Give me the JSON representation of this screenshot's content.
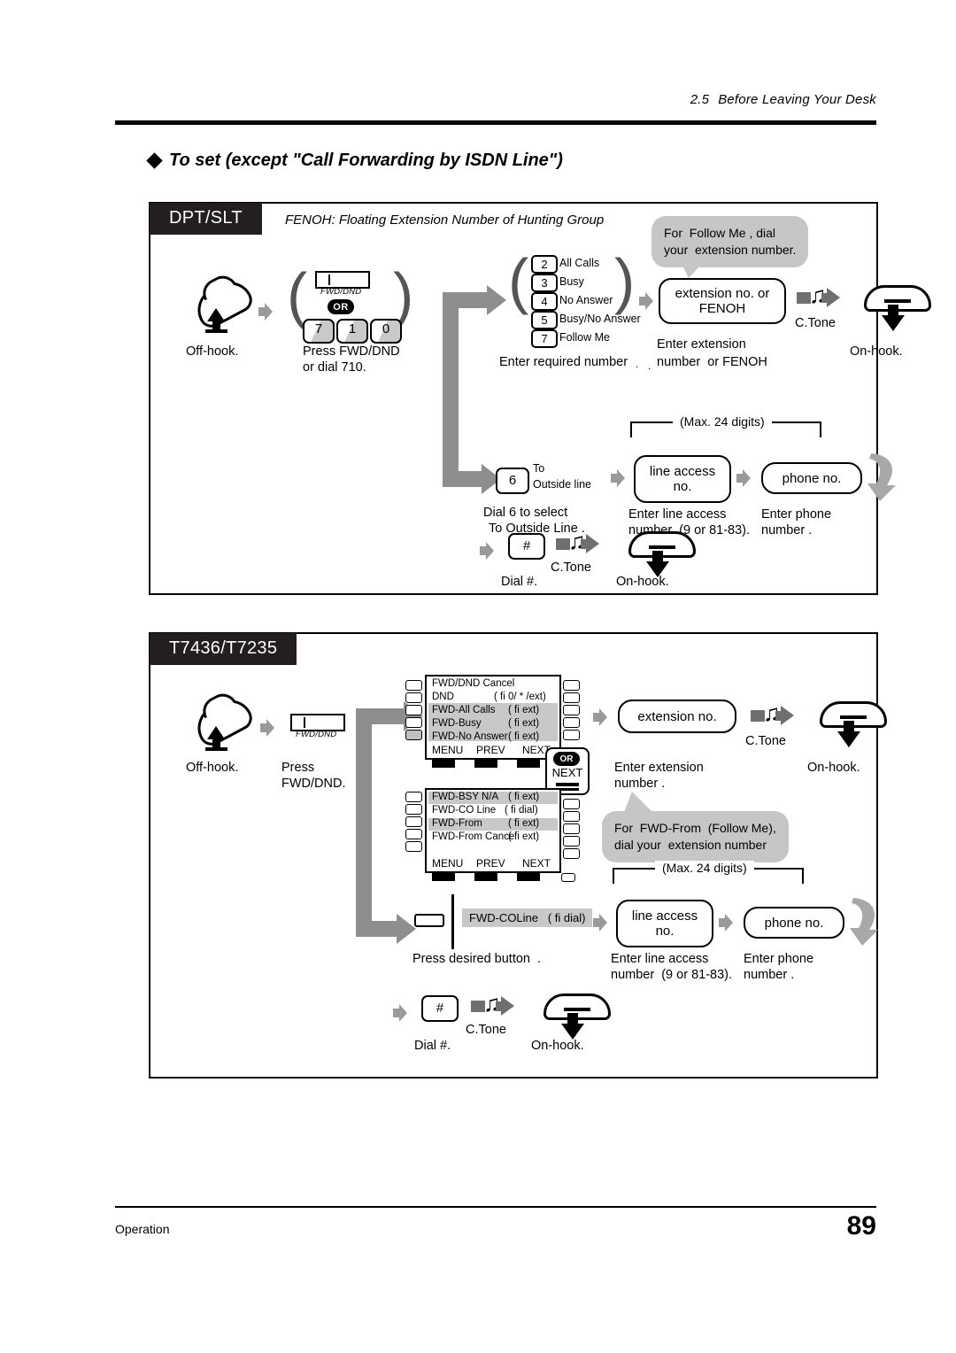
{
  "header": {
    "section_number": "2.5",
    "section_title": "Before Leaving Your Desk"
  },
  "title": "To set (except \"Call Forwarding by ISDN Line\")",
  "panels": [
    {
      "tab": "DPT/SLT",
      "note": "FENOH: Floating Extension Number of Hunting Group",
      "steps": {
        "off_hook": "Off-hook.",
        "press_fwd_dnd": "Press FWD/DND",
        "press_fwd_dnd_2": "or dial 710.",
        "fwd_dnd_key_label": "FWD/DND",
        "or_badge": "OR",
        "dial_keys": [
          "7",
          "1",
          "0"
        ],
        "enter_required": "Enter required number",
        "enter_required_dot": ".",
        "enter_extension_1": "Enter extension",
        "enter_extension_2": "number  or FENOH",
        "enter_extension_dot": ".",
        "c_tone": "C.Tone",
        "on_hook": "On-hook.",
        "extension_box_line1": "extension no. or",
        "extension_box_line2": "FENOH",
        "bubble": "For  Follow Me , dial\nyour  extension number."
      },
      "options": [
        {
          "key": "2",
          "label": "All Calls"
        },
        {
          "key": "3",
          "label": "Busy"
        },
        {
          "key": "4",
          "label": "No Answer"
        },
        {
          "key": "5",
          "label": "Busy/No Answer"
        },
        {
          "key": "7",
          "label": "Follow Me"
        }
      ],
      "outside_line": {
        "key": "6",
        "key_label_1": "To",
        "key_label_2": "Outside line",
        "caption_1": "Dial 6 to select",
        "caption_2": "To Outside Line .",
        "max_digits": "(Max. 24 digits)",
        "line_access_1": "line access",
        "line_access_2": "no.",
        "line_access_cap_1": "Enter line access",
        "line_access_cap_2": "number  (9 or 81-83).",
        "phone_no": "phone no.",
        "phone_cap_1": "Enter phone",
        "phone_cap_2": "number ."
      },
      "finish": {
        "hash_key": "#",
        "dial_hash": "Dial #.",
        "c_tone": "C.Tone",
        "on_hook": "On-hook."
      }
    },
    {
      "tab": "T7436/T7235",
      "steps": {
        "off_hook": "Off-hook.",
        "press_1": "Press",
        "press_2": "FWD/DND.",
        "fwd_dnd_key_label": "FWD/DND",
        "extension_box": "extension no.",
        "enter_extension_1": "Enter extension",
        "enter_extension_2": "number .",
        "c_tone": "C.Tone",
        "on_hook": "On-hook.",
        "bubble": "For  FWD-From  (Follow Me),\ndial your  extension number",
        "or_next_or": "OR",
        "or_next_next": "NEXT"
      },
      "lcd_screen_1": {
        "rows": [
          {
            "label": "FWD/DND Cancel",
            "hint": "",
            "selected": false
          },
          {
            "label": "DND",
            "hint": "( fi 0/ * /ext)",
            "selected": false
          },
          {
            "label": "FWD-All Calls",
            "hint": "( fi ext)",
            "selected": true
          },
          {
            "label": "FWD-Busy",
            "hint": "( fi ext)",
            "selected": true
          },
          {
            "label": "FWD-No Answer",
            "hint": "( fi ext)",
            "selected": true
          }
        ],
        "soft_keys": [
          "MENU",
          "PREV",
          "NEXT"
        ]
      },
      "lcd_screen_2": {
        "rows": [
          {
            "label": "FWD-BSY N/A",
            "hint": "( fi ext)",
            "selected": true
          },
          {
            "label": "FWD-CO Line",
            "hint": "( fi dial)",
            "selected": false
          },
          {
            "label": "FWD-From",
            "hint": "( fi ext)",
            "selected": true
          },
          {
            "label": "FWD-From Cancel",
            "hint": "( fi ext)",
            "selected": false
          }
        ],
        "soft_keys": [
          "MENU",
          "PREV",
          "NEXT"
        ]
      },
      "outside_line": {
        "button_label": "FWD-COLine   ( fi dial)",
        "caption": "Press desired button  .",
        "max_digits": "(Max. 24 digits)",
        "line_access_1": "line access",
        "line_access_2": "no.",
        "line_access_cap_1": "Enter line access",
        "line_access_cap_2": "number  (9 or 81-83).",
        "phone_no": "phone no.",
        "phone_cap_1": "Enter phone",
        "phone_cap_2": "number ."
      },
      "finish": {
        "hash_key": "#",
        "dial_hash": "Dial #.",
        "c_tone": "C.Tone",
        "on_hook": "On-hook."
      }
    }
  ],
  "footer": {
    "left": "Operation",
    "page": "89"
  },
  "colors": {
    "tab_bg": "#231f20",
    "arrow_grey": "#9a9a9a",
    "fat_arrow_grey": "#8e8e8e",
    "bubble_grey": "#c6c6c6",
    "lcd_highlight": "#c8c8c8"
  }
}
